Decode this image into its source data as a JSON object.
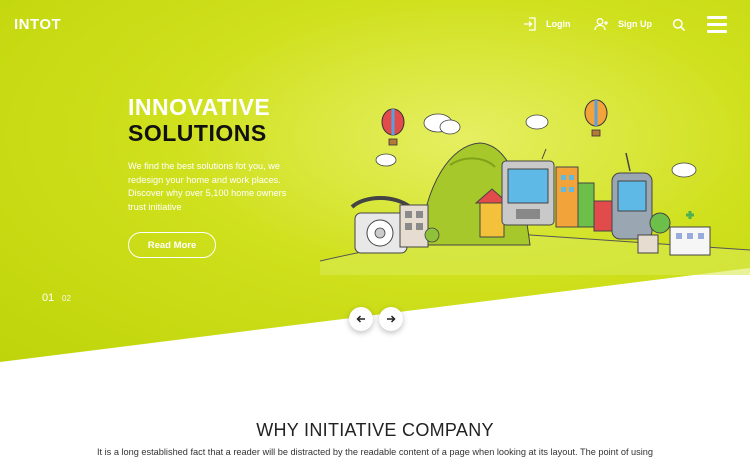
{
  "nav": {
    "logo": "INTOT",
    "login_label": "Login",
    "signup_label": "Sign Up",
    "icons": [
      "login-icon",
      "user-plus-icon",
      "search-icon",
      "menu-icon"
    ]
  },
  "hero": {
    "title_line1": "INNOVATIVE",
    "title_line2": "SOLUTIONS",
    "description": "We find the best solutions fot you, we redesign your home and work places. Discover why over 5,100 home owners trust initiative",
    "button_label": "Read More",
    "pagination": [
      "01",
      "02"
    ],
    "active_page": "01",
    "colors": {
      "background": "#c8dc14",
      "title_accent": "#ffffff",
      "title_dark": "#111111"
    }
  },
  "section": {
    "heading": "WHY INITIATIVE COMPANY",
    "lead": "It is a long established fact that a reader will be distracted by the readable content of a page when looking at its layout. The point of using"
  }
}
